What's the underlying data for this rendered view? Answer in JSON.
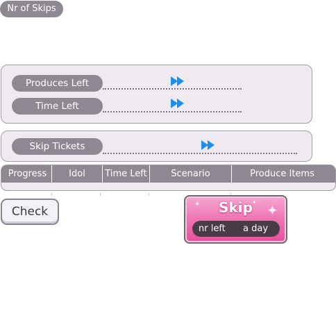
{
  "header": {
    "nr_of_skips_label": "Nr of Skips"
  },
  "produce_panel": {
    "produces_left_label": "Produces Left",
    "time_left_label": "Time Left",
    "fast_forward_icon": "fast-forward-icon"
  },
  "tickets_panel": {
    "skip_tickets_label": "Skip Tickets",
    "fast_forward_icon": "fast-forward-icon"
  },
  "table": {
    "columns": [
      "Progress",
      "Idol",
      "Time Left",
      "Scenario",
      "Produce Items"
    ]
  },
  "actions": {
    "check_label": "Check",
    "skip_label": "Skip",
    "nr_left_label": "nr left",
    "a_day_label": "a day"
  },
  "colors": {
    "accent_blue": "#1e8ff0",
    "pill_gray": "#8e8893",
    "skip_pink": "#ee79b5"
  }
}
